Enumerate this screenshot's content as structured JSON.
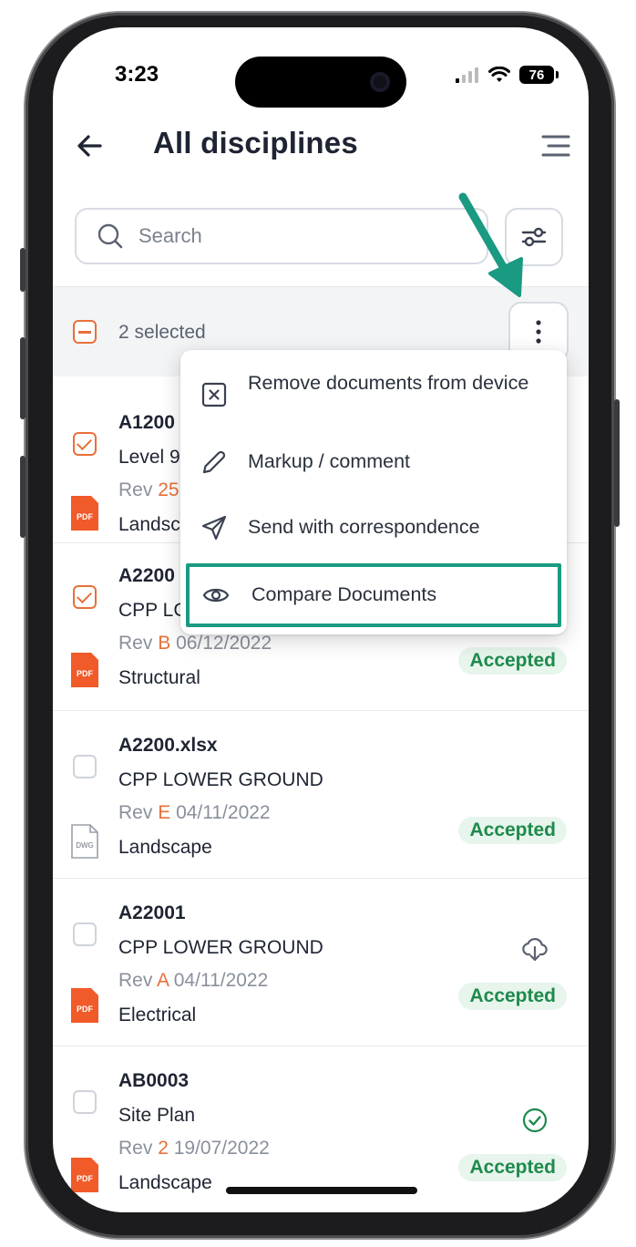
{
  "status": {
    "time": "3:23",
    "battery": "76"
  },
  "header": {
    "title": "All disciplines"
  },
  "search": {
    "placeholder": "Search"
  },
  "selection": {
    "label": "2 selected"
  },
  "menu": {
    "items": [
      {
        "label": "Remove documents from device",
        "icon": "remove-square-icon"
      },
      {
        "label": "Markup / comment",
        "icon": "pencil-icon"
      },
      {
        "label": "Send with correspondence",
        "icon": "send-icon"
      },
      {
        "label": "Compare Documents",
        "icon": "eye-icon"
      }
    ]
  },
  "documents": [
    {
      "name": "A1200",
      "desc": "Level 9",
      "rev_prefix": "Rev",
      "rev": "25",
      "date": "",
      "discipline": "Landsc",
      "file_type": "PDF",
      "checked": true,
      "status": ""
    },
    {
      "name": "A2200",
      "desc": "CPP LC",
      "rev_prefix": "Rev",
      "rev": "B",
      "date": "06/12/2022",
      "discipline": "Structural",
      "file_type": "PDF",
      "checked": true,
      "status": "Accepted"
    },
    {
      "name": "A2200.xlsx",
      "desc": "CPP LOWER GROUND",
      "rev_prefix": "Rev",
      "rev": "E",
      "date": "04/11/2022",
      "discipline": "Landscape",
      "file_type": "DWG",
      "checked": false,
      "status": "Accepted"
    },
    {
      "name": "A22001",
      "desc": "CPP LOWER GROUND",
      "rev_prefix": "Rev",
      "rev": "A",
      "date": "04/11/2022",
      "discipline": "Electrical",
      "file_type": "PDF",
      "checked": false,
      "status": "Accepted"
    },
    {
      "name": "AB0003",
      "desc": "Site Plan",
      "rev_prefix": "Rev",
      "rev": "2",
      "date": "19/07/2022",
      "discipline": "Landscape",
      "file_type": "PDF",
      "checked": false,
      "status": "Accepted"
    }
  ],
  "colors": {
    "accent": "#e8703a",
    "success": "#1e8a4c",
    "highlight": "#1b9a82"
  }
}
